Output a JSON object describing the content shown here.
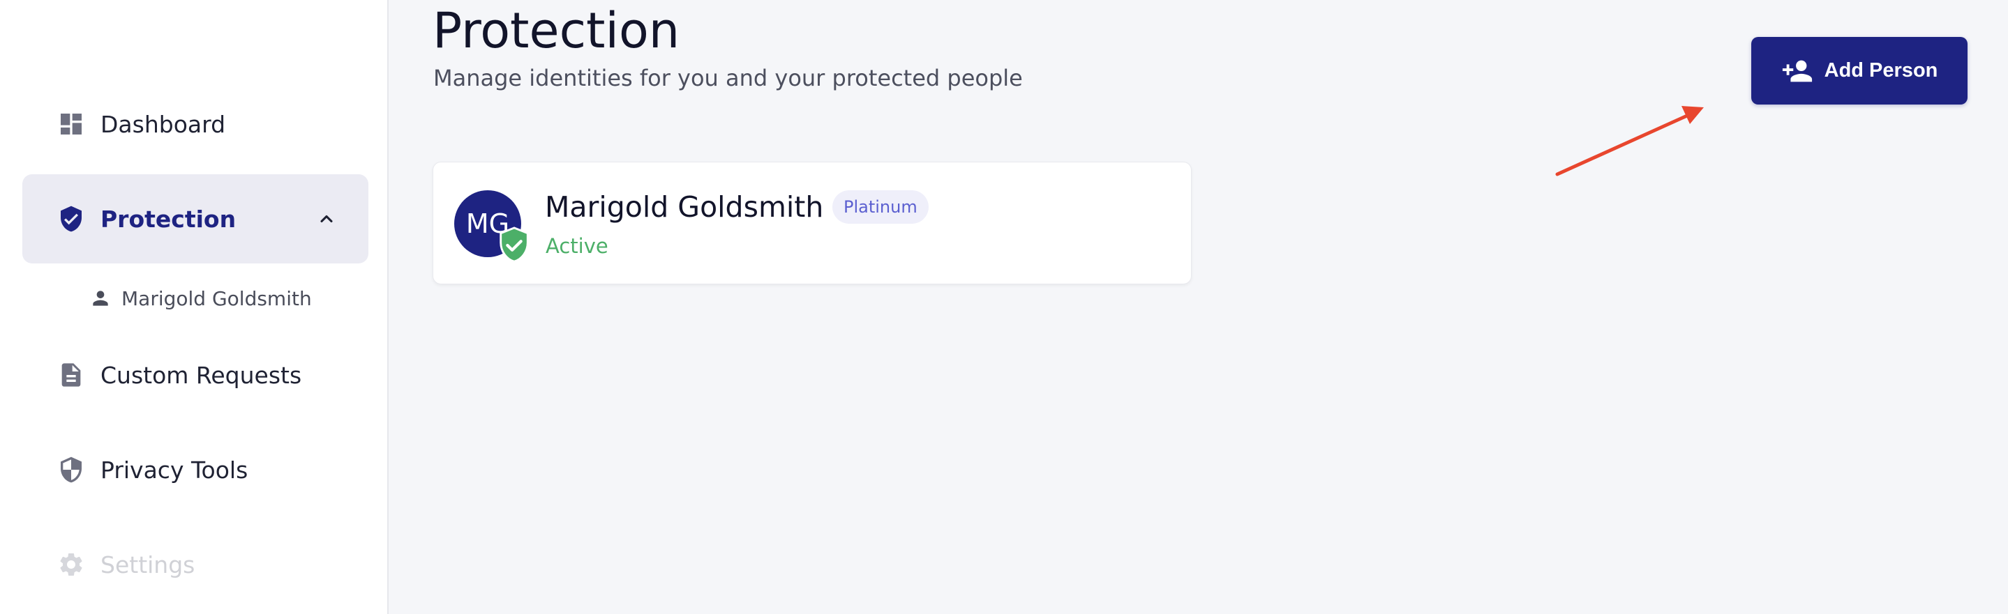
{
  "sidebar": {
    "items": [
      {
        "label": "Dashboard",
        "icon": "dashboard-icon"
      },
      {
        "label": "Protection",
        "icon": "shield-check-icon",
        "active": true
      },
      {
        "label": "Custom Requests",
        "icon": "document-icon"
      },
      {
        "label": "Privacy Tools",
        "icon": "half-shield-icon"
      },
      {
        "label": "Settings",
        "icon": "gear-icon",
        "disabled": true
      }
    ],
    "sub_items": [
      {
        "label": "Marigold Goldsmith",
        "icon": "person-icon"
      }
    ]
  },
  "header": {
    "title": "Protection",
    "subtitle": "Manage identities for you and your protected people",
    "add_button_label": "Add Person",
    "add_button_icon": "person-add-icon"
  },
  "people": [
    {
      "initials": "MG",
      "name": "Marigold Goldsmith",
      "tier": "Platinum",
      "status": "Active"
    }
  ],
  "colors": {
    "accent": "#1e2382",
    "active_bg": "#ebebf3",
    "status_active": "#4caf68",
    "tier_text": "#5b5fd0",
    "tier_bg": "#efeffa",
    "annotation_arrow": "#e8462e"
  }
}
